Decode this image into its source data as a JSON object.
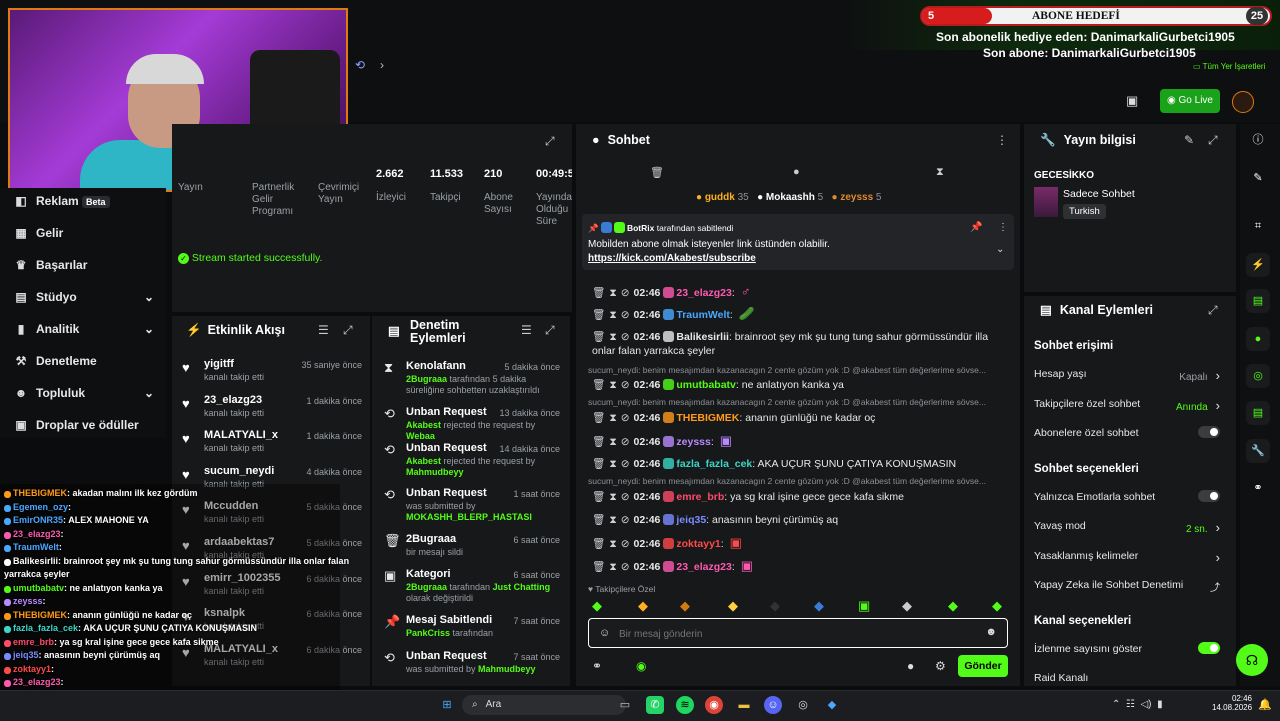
{
  "overlay": {
    "goal_title": "ABONE HEDEFİ",
    "goal_current": "5",
    "goal_target": "25",
    "gift_line": "Son abonelik hediye eden: DanimarkaliGurbetci1905",
    "sub_line": "Son abone: DanimarkaliGurbetci1905",
    "bookmarks": "Tüm Yer İşaretleri"
  },
  "header": {
    "go_live": "Go Live"
  },
  "sidebar": {
    "items": [
      {
        "label": "Reklam",
        "badge": "Beta"
      },
      {
        "label": "Gelir"
      },
      {
        "label": "Başarılar"
      },
      {
        "label": "Stüdyo"
      },
      {
        "label": "Analitik"
      },
      {
        "label": "Denetleme"
      },
      {
        "label": "Topluluk"
      },
      {
        "label": "Droplar ve ödüller"
      }
    ]
  },
  "stats": [
    {
      "value": "",
      "label": "Yayın"
    },
    {
      "value": "",
      "label": "Partnerlik Gelir Programı"
    },
    {
      "value": "",
      "label": "Çevrimiçi Yayın"
    },
    {
      "value": "2.662",
      "label": "İzleyici"
    },
    {
      "value": "11.533",
      "label": "Takipçi"
    },
    {
      "value": "210",
      "label": "Abone Sayısı"
    },
    {
      "value": "00:49:5",
      "label": "Yayında Olduğu Süre"
    }
  ],
  "status_message": "Stream started successfully.",
  "activity": {
    "title": "Etkinlik Akışı",
    "items": [
      {
        "name": "yigitff",
        "sub": "kanalı takip etti",
        "time": "35 saniye önce"
      },
      {
        "name": "23_elazg23",
        "sub": "kanalı takip etti",
        "time": "1 dakika önce"
      },
      {
        "name": "MALATYALI_x",
        "sub": "kanalı takip etti",
        "time": "1 dakika önce"
      },
      {
        "name": "sucum_neydi",
        "sub": "kanalı takip etti",
        "time": "4 dakika önce"
      },
      {
        "name": "Mccudden",
        "sub": "kanalı takip etti",
        "time": "5 dakika önce"
      },
      {
        "name": "ardaabektas7",
        "sub": "kanalı takip etti",
        "time": "5 dakika önce"
      },
      {
        "name": "emirr_1002355",
        "sub": "kanalı takip etti",
        "time": "6 dakika önce"
      },
      {
        "name": "ksnalpk",
        "sub": "kanalı takip etti",
        "time": "6 dakika önce"
      },
      {
        "name": "MALATYALI_x",
        "sub": "kanalı takip etti",
        "time": "6 dakika önce"
      }
    ]
  },
  "moderation": {
    "title": "Denetim Eylemleri",
    "items": [
      {
        "title": "Kenolafann",
        "time": "5 dakika önce",
        "pre": "",
        "actor": "2Bugraaa",
        "post": " tarafından 5 dakika süreliğine sohbetten uzaklaştırıldı",
        "icon": "hourglass"
      },
      {
        "title": "Unban Request",
        "time": "13 dakika önce",
        "pre": "",
        "actor": "Akabest",
        "post": " rejected the request by ",
        "actor2": "Webaa",
        "icon": "history"
      },
      {
        "title": "Unban Request",
        "time": "14 dakika önce",
        "pre": "",
        "actor": "Akabest",
        "post": " rejected the request by ",
        "actor2": "Mahmudbeyy",
        "icon": "history"
      },
      {
        "title": "Unban Request",
        "time": "1 saat önce",
        "pre": "was submitted by ",
        "actor": "MOKASHH_BLERP_HASTASI",
        "post": "",
        "icon": "history"
      },
      {
        "title": "2Bugraaa",
        "time": "6 saat önce",
        "pre": "bir mesajı sildi",
        "actor": "",
        "post": "",
        "icon": "trash"
      },
      {
        "title": "Kategori",
        "time": "6 saat önce",
        "pre": "",
        "actor": "2Bugraaa",
        "post": " tarafından ",
        "actor2": "Just Chatting",
        "post2": " olarak değiştirildi",
        "icon": "category"
      },
      {
        "title": "Mesaj Sabitlendi",
        "time": "7 saat önce",
        "pre": "",
        "actor": "PankCriss",
        "post": " tarafından",
        "icon": "pin"
      },
      {
        "title": "Unban Request",
        "time": "7 saat önce",
        "pre": "was submitted by ",
        "actor": "Mahmudbeyy",
        "post": "",
        "icon": "history"
      }
    ]
  },
  "chat": {
    "title": "Sohbet",
    "top_gifters": [
      {
        "name": "guddk",
        "count": "35"
      },
      {
        "name": "Mokaashh",
        "count": "5"
      },
      {
        "name": "zeysss",
        "count": "5"
      }
    ],
    "pinned": {
      "by": "BotRix",
      "by_suffix": "tarafından sabitlendi",
      "text": "Mobilden abone olmak isteyenler link üstünden olabilir.",
      "link": "https://kick.com/Akabest/subscribe"
    },
    "messages": [
      {
        "time": "02:46",
        "user": "23_elazg23",
        "color": "#ff5ab0",
        "text": ":",
        "emote": "♂"
      },
      {
        "time": "02:46",
        "user": "TraumWelt",
        "color": "#4aa8ff",
        "text": ":",
        "emote": "🥒"
      },
      {
        "time": "02:46",
        "user": "Balikesirlii",
        "color": "#e8e8e8",
        "text": ": brainroot şey mk şu tung tung sahur görmüssündür illa onlar falan yarrakca şeyler"
      },
      {
        "sys": "sucum_neydi: benim mesajımdan kazanacagın 2 cente gözüm yok :D @akabest tüm değerlerime sövse..."
      },
      {
        "time": "02:46",
        "user": "umutbabatv",
        "color": "#53fc18",
        "text": ": ne anlatıyon kanka ya"
      },
      {
        "sys": "sucum_neydi: benim mesajımdan kazanacagın 2 cente gözüm yok :D @akabest tüm değerlerime sövse..."
      },
      {
        "time": "02:46",
        "user": "THEBIGMEK",
        "color": "#ff9a1a",
        "text": ": ananın günlüğü ne kadar oç"
      },
      {
        "time": "02:46",
        "user": "zeysss",
        "color": "#b98aff",
        "text": ":",
        "emote": "▣"
      },
      {
        "time": "02:46",
        "user": "fazla_fazla_cek",
        "color": "#3ad6c6",
        "text": ": AKA UÇUR ŞUNU ÇATIYA KONUŞMASIN"
      },
      {
        "sys": "sucum_neydi: benim mesajımdan kazanacagın 2 cente gözüm yok :D @akabest tüm değerlerime sövse..."
      },
      {
        "time": "02:46",
        "user": "emre_brb",
        "color": "#ff4a6a",
        "text": ": ya sg kral işine gece gece kafa sikme"
      },
      {
        "time": "02:46",
        "user": "jeiq35",
        "color": "#7a8cff",
        "text": ": anasının beyni çürümüş aq"
      },
      {
        "time": "02:46",
        "user": "zoktayy1",
        "color": "#ff4a4a",
        "text": ":",
        "emote": "▣"
      },
      {
        "time": "02:46",
        "user": "23_elazg23",
        "color": "#ff5ab0",
        "text": ":",
        "emote": "▣"
      }
    ],
    "followers_only": "Takipçilere Özel",
    "input_placeholder": "Bir mesaj gönderin",
    "send": "Gönder"
  },
  "stream_info": {
    "title": "Yayın bilgisi",
    "channel": "GECESİKKO",
    "category": "Sadece Sohbet",
    "tag": "Turkish"
  },
  "channel_actions": {
    "title": "Kanal Eylemleri",
    "sections": [
      {
        "label": "Sohbet erişimi",
        "options": [
          {
            "label": "Hesap yaşı",
            "value": "Kapalı",
            "kind": "chev"
          },
          {
            "label": "Takipçilere özel sohbet",
            "value": "Anında",
            "kind": "chev"
          },
          {
            "label": "Abonelere özel sohbet",
            "value": "",
            "kind": "toggle-off"
          }
        ]
      },
      {
        "label": "Sohbet seçenekleri",
        "options": [
          {
            "label": "Yalnızca Emotlarla sohbet",
            "value": "",
            "kind": "toggle-off"
          },
          {
            "label": "Yavaş mod",
            "value": "2 sn.",
            "kind": "chev"
          },
          {
            "label": "Yasaklanmış kelimeler",
            "value": "",
            "kind": "chev"
          },
          {
            "label": "Yapay Zeka ile Sohbet Denetimi",
            "value": "",
            "kind": "ext"
          }
        ]
      },
      {
        "label": "Kanal seçenekleri",
        "options": [
          {
            "label": "İzlenme sayısını göster",
            "value": "",
            "kind": "toggle-on"
          },
          {
            "label": "Raid Kanalı",
            "value": "",
            "kind": "none"
          }
        ]
      }
    ]
  },
  "overlay_chat": [
    {
      "user": "THEBIGMEK",
      "color": "#ff9a1a",
      "text": ": akadan malını ilk kez gördüm"
    },
    {
      "user": "Egemen_ozy",
      "color": "#4aa8ff",
      "text": ":"
    },
    {
      "user": "EmirONR35",
      "color": "#4aa8ff",
      "text": ": ALEX MAHONE YA"
    },
    {
      "user": "23_elazg23",
      "color": "#ff5ab0",
      "text": ":"
    },
    {
      "user": "TraumWelt",
      "color": "#4aa8ff",
      "text": ":"
    },
    {
      "user": "Balikesirlii",
      "color": "#fff",
      "text": ": brainroot şey mk şu tung tung sahur görmüssündür illa onlar falan"
    },
    {
      "user": "",
      "color": "#fff",
      "text": "yarrakca şeyler"
    },
    {
      "user": "umutbabatv",
      "color": "#53fc18",
      "text": ": ne anlatıyon kanka ya"
    },
    {
      "user": "zeysss",
      "color": "#b98aff",
      "text": ":"
    },
    {
      "user": "THEBIGMEK",
      "color": "#ff9a1a",
      "text": ": ananın günlüğü ne kadar oç"
    },
    {
      "user": "fazla_fazla_cek",
      "color": "#3ad6c6",
      "text": ": AKA UÇUR ŞUNU ÇATIYA KONUŞMASIN"
    },
    {
      "user": "emre_brb",
      "color": "#ff4a6a",
      "text": ": ya sg kral işine gece gece kafa sikme"
    },
    {
      "user": "jeiq35",
      "color": "#7a8cff",
      "text": ": anasının beyni çürümüş aq"
    },
    {
      "user": "zoktayy1",
      "color": "#ff4a4a",
      "text": ":"
    },
    {
      "user": "23_elazg23",
      "color": "#ff5ab0",
      "text": ":"
    }
  ],
  "taskbar": {
    "search": "Ara",
    "time": "02:46",
    "date": "14.08.2026"
  }
}
